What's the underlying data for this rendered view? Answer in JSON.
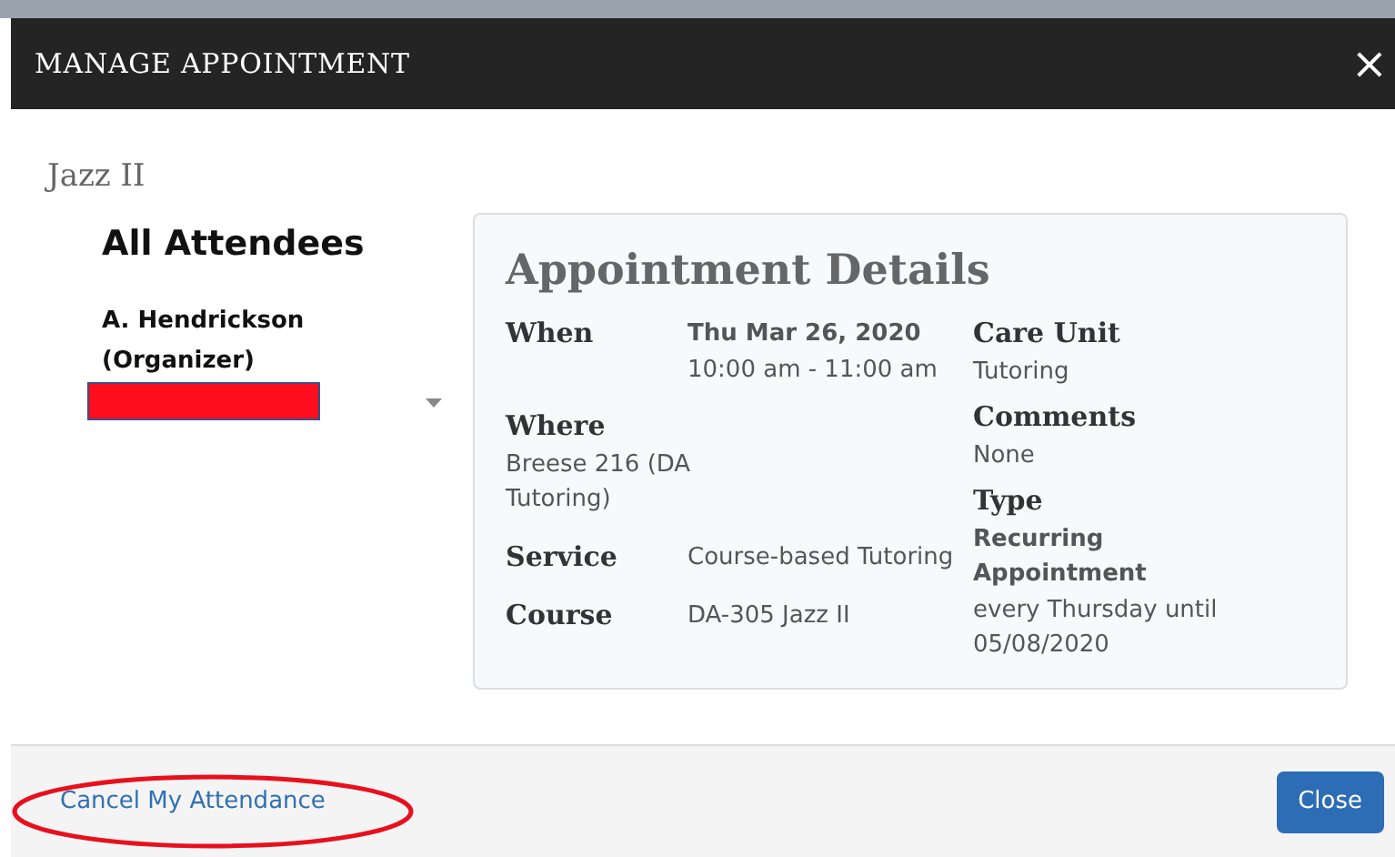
{
  "dialog": {
    "title": "MANAGE APPOINTMENT",
    "close_icon": "×"
  },
  "subject": "Jazz II",
  "attendees": {
    "heading": "All Attendees",
    "items": [
      {
        "name": "A. Hendrickson",
        "role": "(Organizer)"
      }
    ]
  },
  "details": {
    "title": "Appointment Details",
    "left": [
      {
        "label": "When",
        "kind": "stacked_inline",
        "lines": [
          {
            "text": "Thu Mar 26, 2020",
            "bold": true
          },
          {
            "text": "10:00 am - 11:00 am",
            "bold": false
          }
        ]
      },
      {
        "label": "Where",
        "kind": "below",
        "lines": [
          {
            "text": "Breese 216 (DA Tutoring)",
            "bold": false
          }
        ]
      },
      {
        "label": "Service",
        "kind": "stacked_inline",
        "lines": [
          {
            "text": "Course-based Tutoring",
            "bold": false
          }
        ]
      },
      {
        "label": "Course",
        "kind": "stacked_inline",
        "lines": [
          {
            "text": "DA-305 Jazz II",
            "bold": false
          }
        ]
      }
    ],
    "right": [
      {
        "label": "Care Unit",
        "lines": [
          {
            "text": "Tutoring",
            "bold": false
          }
        ]
      },
      {
        "label": "Comments",
        "lines": [
          {
            "text": "None",
            "bold": false
          }
        ]
      },
      {
        "label": "Type",
        "lines": [
          {
            "text": "Recurring Appointment",
            "bold": true
          },
          {
            "text": "every Thursday until 05/08/2020",
            "bold": false
          }
        ]
      }
    ]
  },
  "footer": {
    "link": "Cancel My Attendance",
    "button": "Close"
  }
}
